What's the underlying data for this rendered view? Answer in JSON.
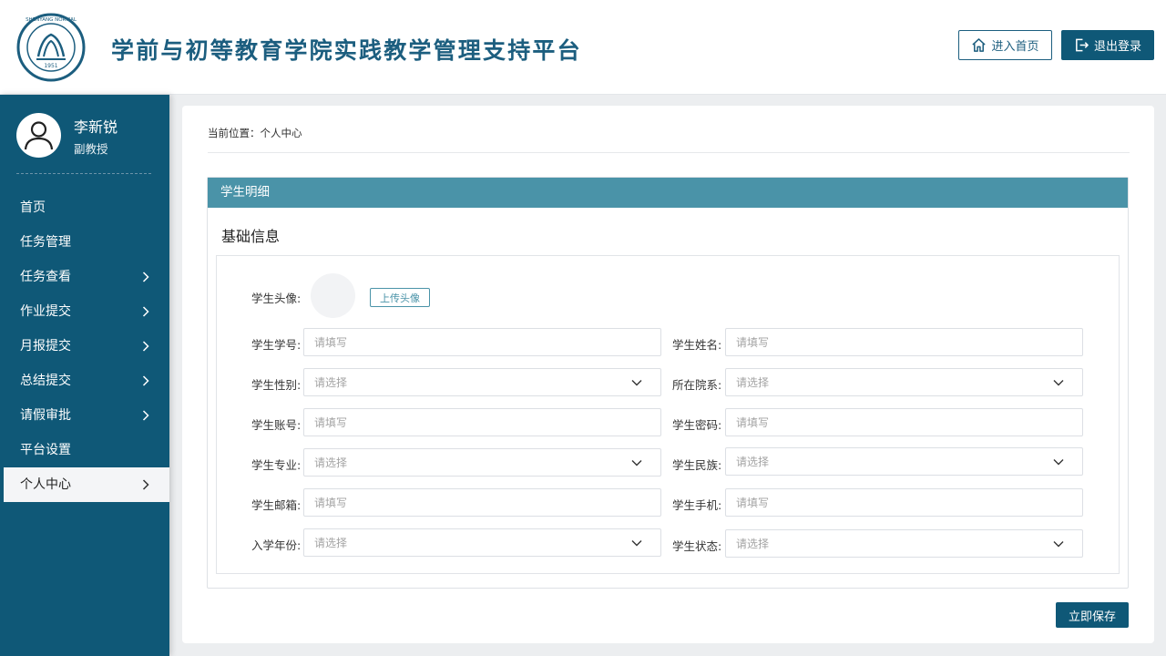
{
  "header": {
    "title": "学前与初等教育学院实践教学管理支持平台",
    "home_label": "进入首页",
    "logout_label": "退出登录"
  },
  "user": {
    "name": "李新锐",
    "title": "副教授"
  },
  "sidebar": {
    "items": [
      {
        "label": "首页",
        "has_arrow": false
      },
      {
        "label": "任务管理",
        "has_arrow": false
      },
      {
        "label": "任务查看",
        "has_arrow": true
      },
      {
        "label": "作业提交",
        "has_arrow": true
      },
      {
        "label": "月报提交",
        "has_arrow": true
      },
      {
        "label": "总结提交",
        "has_arrow": true
      },
      {
        "label": "请假审批",
        "has_arrow": true
      },
      {
        "label": "平台设置",
        "has_arrow": false
      },
      {
        "label": "个人中心",
        "has_arrow": true,
        "active": true
      }
    ]
  },
  "breadcrumb": "当前位置：个人中心",
  "panel": {
    "title": "学生明细",
    "section": "基础信息"
  },
  "form": {
    "avatar_label": "学生头像:",
    "upload_label": "上传头像",
    "fields": {
      "student_no": {
        "label": "学生学号:",
        "placeholder": "请填写"
      },
      "student_name": {
        "label": "学生姓名:",
        "placeholder": "请填写"
      },
      "gender": {
        "label": "学生性别:",
        "placeholder": "请选择"
      },
      "department": {
        "label": "所在院系:",
        "placeholder": "请选择"
      },
      "account": {
        "label": "学生账号:",
        "placeholder": "请填写"
      },
      "password": {
        "label": "学生密码:",
        "placeholder": "请填写"
      },
      "major": {
        "label": "学生专业:",
        "placeholder": "请选择"
      },
      "ethnicity": {
        "label": "学生民族:",
        "placeholder": "请选择"
      },
      "email": {
        "label": "学生邮箱:",
        "placeholder": "请填写"
      },
      "phone": {
        "label": "学生手机:",
        "placeholder": "请填写"
      },
      "enroll_year": {
        "label": "入学年份:",
        "placeholder": "请选择"
      },
      "status": {
        "label": "学生状态:",
        "placeholder": "请选择"
      }
    }
  },
  "save_label": "立即保存",
  "colors": {
    "primary": "#0f5877",
    "panel_header": "#4a93a8",
    "background": "#eceef0"
  },
  "icons": {
    "home": "home-icon",
    "logout": "logout-icon",
    "chevron": "chevron-right-icon",
    "dropdown": "chevron-down-icon"
  }
}
